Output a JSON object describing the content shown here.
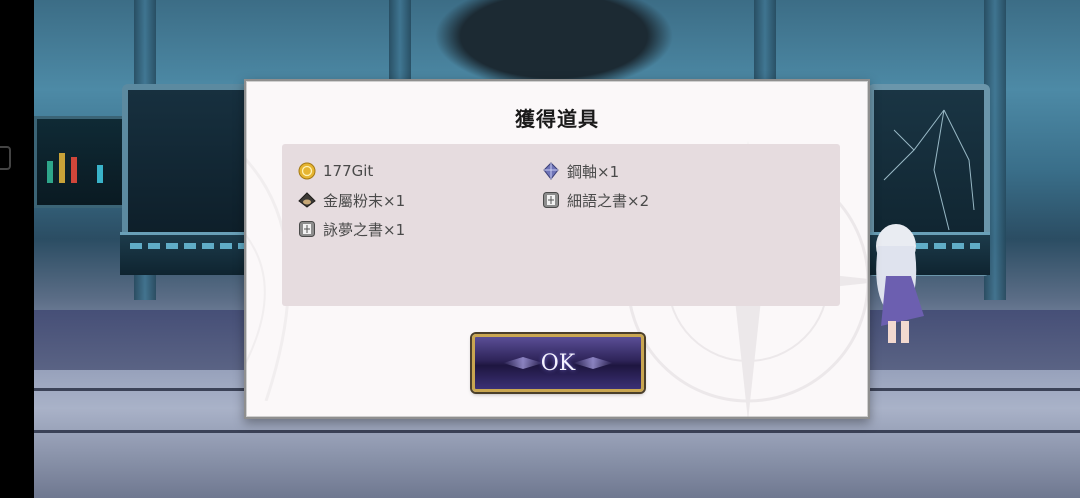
{
  "dialog": {
    "title": "獲得道具",
    "items": [
      {
        "label": "177Git",
        "icon": "gold-coin-icon"
      },
      {
        "label": "鋼軸×1",
        "icon": "steel-shaft-icon"
      },
      {
        "label": "金屬粉末×1",
        "icon": "metal-powder-icon"
      },
      {
        "label": "細語之書×2",
        "icon": "whisper-book-icon"
      },
      {
        "label": "詠夢之書×1",
        "icon": "dream-book-icon"
      }
    ],
    "ok_label": "OK"
  },
  "colors": {
    "dialog_bg": "#fbf8f9",
    "items_box_bg": "#e6dcdf",
    "button_border": "#c9a651",
    "button_bg": "#2e2459"
  }
}
